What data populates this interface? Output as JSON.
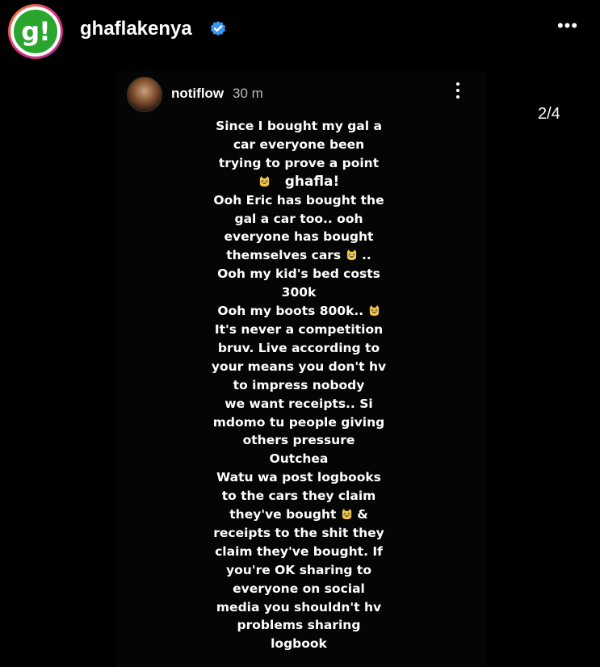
{
  "header": {
    "avatar_letter": "g!",
    "username": "ghaflakenya",
    "verified_icon": "verified-badge-icon",
    "more_label": "•••"
  },
  "story": {
    "username": "notiflow",
    "time": "30 m",
    "counter": "2/4",
    "watermark": "ghafla!",
    "lines": [
      "Since I bought my gal a",
      "car everyone been",
      "trying to prove a point",
      "",
      "Ooh Eric has bought the",
      "gal a car too.. ooh",
      "everyone has bought",
      "themselves cars",
      "Ooh my kid's bed costs",
      "300k",
      "Ooh my boots 800k..",
      "It's never a competition",
      "bruv. Live according to",
      "your means you don't hv",
      "to impress nobody",
      "we want receipts.. Si",
      "mdomo tu people giving",
      "others pressure",
      "Outchea",
      "Watu wa post logbooks",
      "to the cars they claim",
      "they've bought",
      "receipts to the shit they",
      "claim they've bought. If",
      "you're OK sharing to",
      "everyone on social",
      "media you shouldn't hv",
      "problems sharing",
      "logbook"
    ],
    "line8_suffix": " ..",
    "line21_suffix": " &"
  },
  "colors": {
    "brand_green": "#2aa52e",
    "verified_blue": "#3897f0"
  }
}
